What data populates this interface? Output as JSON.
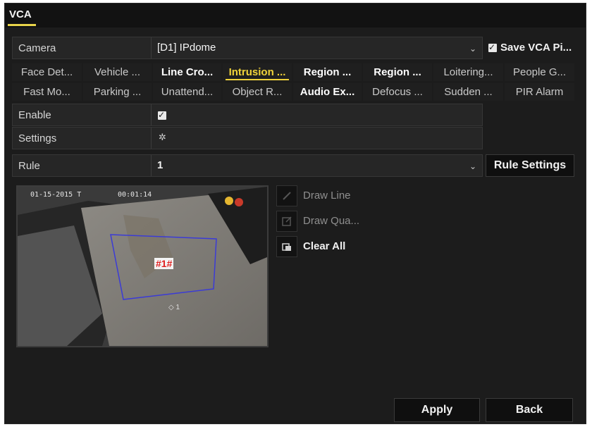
{
  "window": {
    "title": "VCA"
  },
  "camera": {
    "label": "Camera",
    "value": "[D1] IPdome",
    "save_label": "Save VCA Pi..."
  },
  "tabs": [
    [
      "Face Det...",
      "Vehicle ...",
      "Line Cro...",
      "Intrusion ...",
      "Region ...",
      "Region ...",
      "Loitering...",
      "People G..."
    ],
    [
      "Fast Mo...",
      "Parking ...",
      "Unattend...",
      "Object R...",
      "Audio Ex...",
      "Defocus ...",
      "Sudden ...",
      "PIR Alarm"
    ]
  ],
  "active_tab": "Intrusion ...",
  "enable": {
    "label": "Enable",
    "checked": true
  },
  "settings": {
    "label": "Settings",
    "icon": "gear-icon"
  },
  "rule": {
    "label": "Rule",
    "value": "1",
    "button": "Rule Settings"
  },
  "video": {
    "timestamp": "01-15-2015 T",
    "time": "00:01:14",
    "region_tag": "#1#",
    "cam_label": "1"
  },
  "tools": {
    "draw_line": "Draw Line",
    "draw_quad": "Draw Qua...",
    "clear_all": "Clear All"
  },
  "footer": {
    "apply": "Apply",
    "back": "Back"
  },
  "colors": {
    "accent": "#f0d23a",
    "region_box": "#3b3bd6",
    "region_tag": "#e02020"
  }
}
